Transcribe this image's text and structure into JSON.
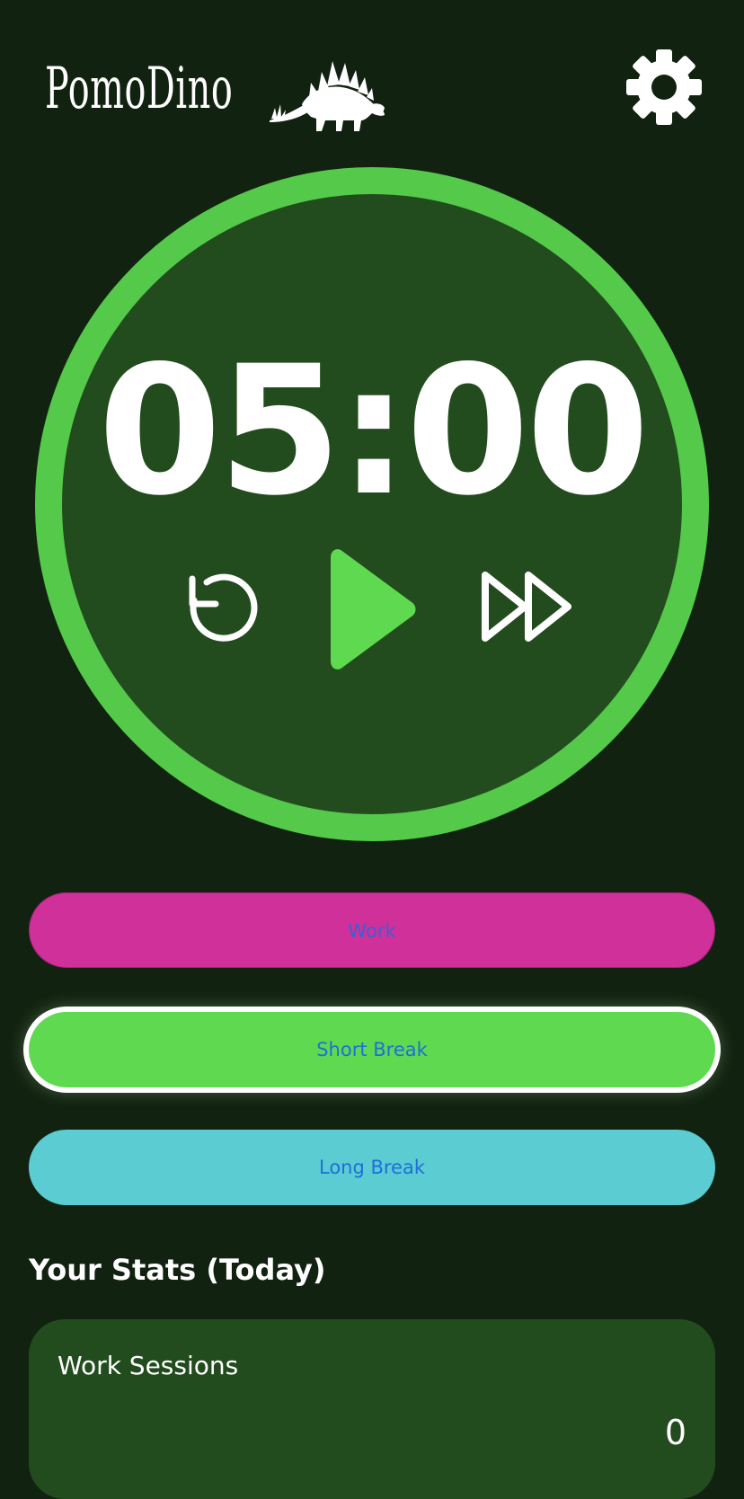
{
  "app": {
    "title": "PomoDino",
    "logo_icon": "stegosaurus-icon",
    "settings_icon": "gear-icon"
  },
  "timer": {
    "display": "05:00",
    "controls": {
      "reset_icon": "reset-icon",
      "play_icon": "play-icon",
      "skip_icon": "fast-forward-icon"
    }
  },
  "modes": {
    "work_label": "Work",
    "short_break_label": "Short Break",
    "long_break_label": "Long Break",
    "selected": "Short Break"
  },
  "stats": {
    "heading": "Your Stats (Today)",
    "work_sessions_label": "Work Sessions",
    "work_sessions_value": "0"
  },
  "colors": {
    "background": "#122210",
    "panel": "#234c1e",
    "ring": "#54c94a",
    "play": "#5fd94f",
    "work": "#d0309a",
    "short_break": "#5fd94f",
    "long_break": "#5accd2",
    "button_text": "#1f6fd6"
  }
}
